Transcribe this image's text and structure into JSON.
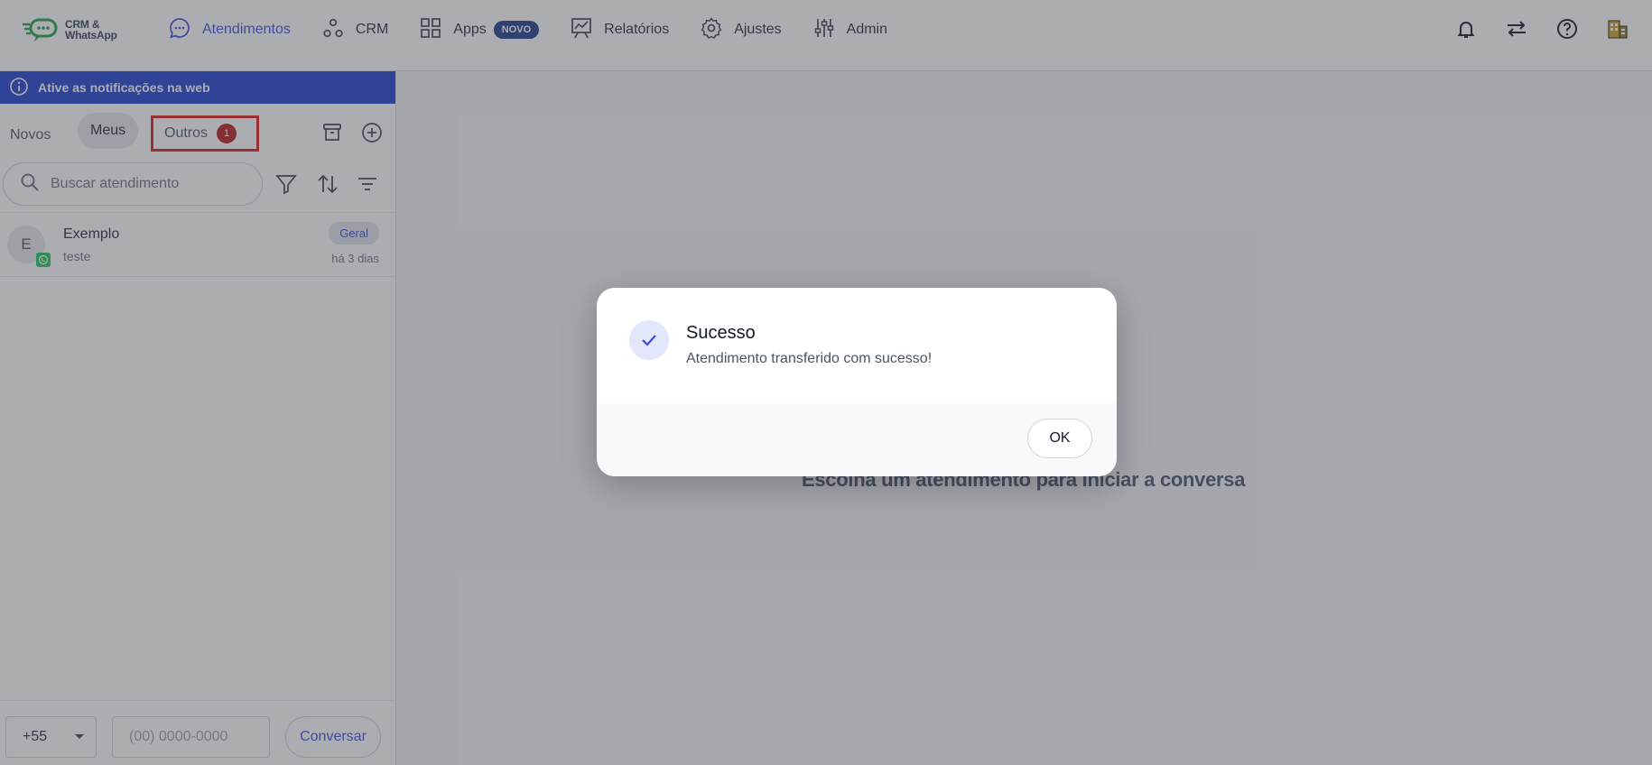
{
  "colors": {
    "accent": "#3b4fd9",
    "notice_bg": "#1d3fcf",
    "badge_red": "#b91c1c",
    "highlight_border": "#e11d1d",
    "whatsapp_green": "#22c55e"
  },
  "logo": {
    "line1": "CRM &",
    "line2": "WhatsApp"
  },
  "nav": {
    "items": [
      {
        "label": "Atendimentos",
        "icon": "chat-bubble-icon",
        "active": true
      },
      {
        "label": "CRM",
        "icon": "nodes-icon"
      },
      {
        "label": "Apps",
        "icon": "grid-icon",
        "badge": "NOVO"
      },
      {
        "label": "Relatórios",
        "icon": "chart-board-icon"
      },
      {
        "label": "Ajustes",
        "icon": "gear-icon"
      },
      {
        "label": "Admin",
        "icon": "sliders-icon"
      }
    ]
  },
  "top_actions": [
    "bell-icon",
    "transfer-arrows-icon",
    "help-circle-icon",
    "building-icon"
  ],
  "sidebar": {
    "notice": "Ative as notificações na web",
    "tabs": {
      "novos": "Novos",
      "meus": "Meus",
      "outros": "Outros",
      "outros_count": "1"
    },
    "search": {
      "placeholder": "Buscar atendimento"
    },
    "conversations": [
      {
        "initial": "E",
        "name": "Exemplo",
        "preview": "teste",
        "tag": "Geral",
        "time": "há 3 dias",
        "channel": "whatsapp-icon"
      }
    ],
    "bottom": {
      "ddi": "+55",
      "phone_placeholder": "(00) 0000-0000",
      "button": "Conversar"
    }
  },
  "main": {
    "empty_message": "Escolha um atendimento para iniciar a conversa"
  },
  "modal": {
    "title": "Sucesso",
    "message": "Atendimento transferido com sucesso!",
    "ok_label": "OK"
  }
}
